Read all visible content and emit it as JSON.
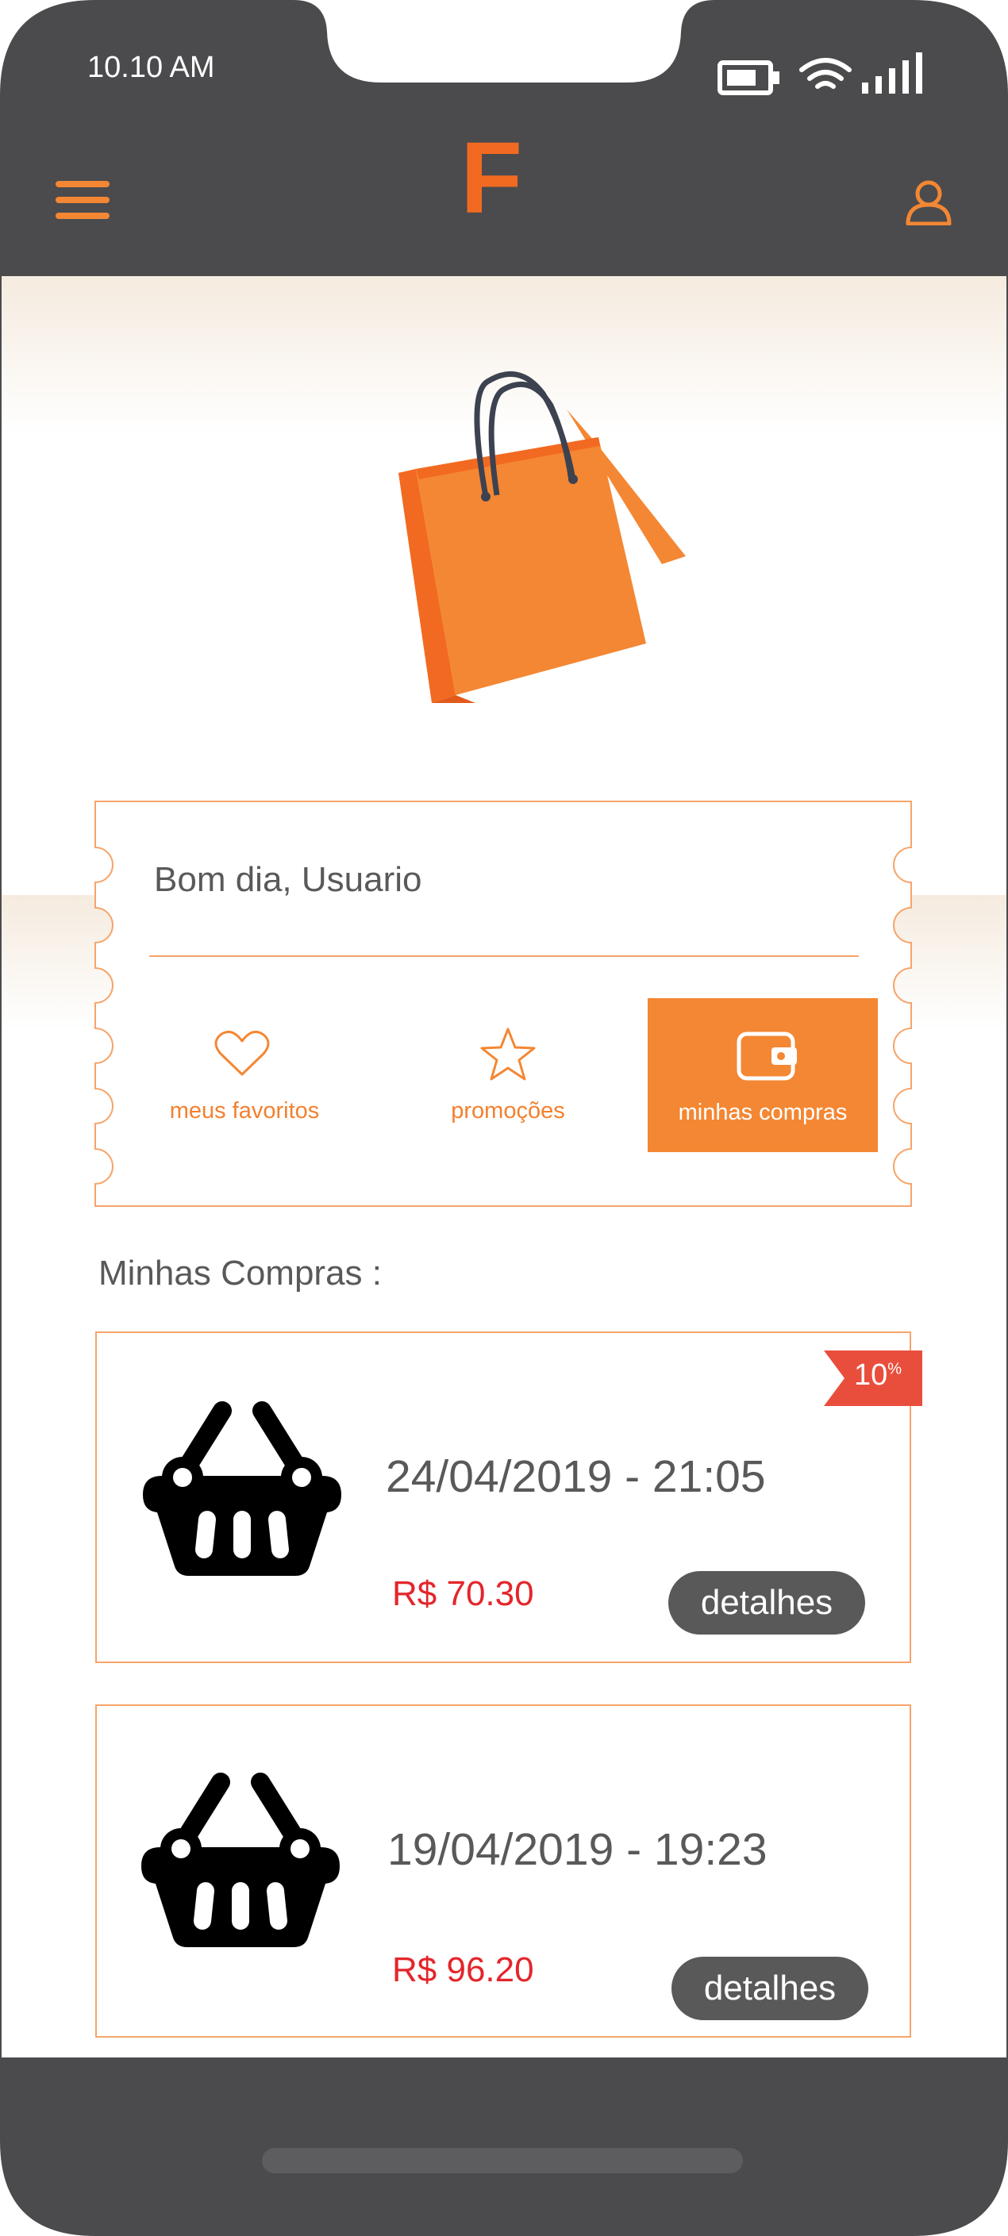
{
  "status_bar": {
    "time": "10.10 AM"
  },
  "header": {
    "brand": "F"
  },
  "greeting": "Bom dia, Usuario",
  "actions": [
    {
      "label": "meus favoritos"
    },
    {
      "label": "promoções"
    },
    {
      "label": "minhas compras"
    }
  ],
  "section_title": "Minhas Compras :",
  "purchases": [
    {
      "date": "24/04/2019 -  21:05",
      "price": "R$ 70.30",
      "details": "detalhes",
      "discount": "10",
      "discount_unit": "%"
    },
    {
      "date": "19/04/2019 -  19:23",
      "price": "R$ 96.20",
      "details": "detalhes"
    }
  ],
  "colors": {
    "accent": "#f48733",
    "dark": "#4b4b4d",
    "price": "#e3262b",
    "badge": "#e94e3c"
  }
}
